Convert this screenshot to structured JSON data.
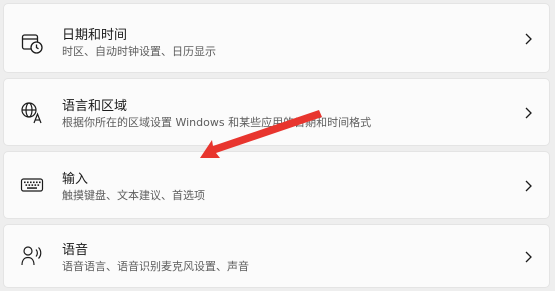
{
  "settings": {
    "items": [
      {
        "title": "日期和时间",
        "subtitle": "时区、自动时钟设置、日历显示",
        "icon": "calendar-clock-icon"
      },
      {
        "title": "语言和区域",
        "subtitle": "根据你所在的区域设置 Windows 和某些应用的日期和时间格式",
        "icon": "language-icon"
      },
      {
        "title": "输入",
        "subtitle": "触摸键盘、文本建议、首选项",
        "icon": "keyboard-icon"
      },
      {
        "title": "语音",
        "subtitle": "语音语言、语音识别麦克风设置、声音",
        "icon": "speech-icon"
      }
    ]
  },
  "annotation": {
    "arrow_color": "#e8352e"
  }
}
